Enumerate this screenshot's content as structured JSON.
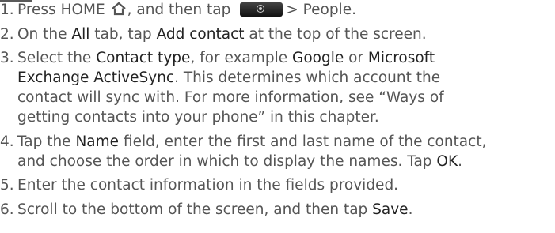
{
  "steps": [
    {
      "num": "1.",
      "parts": {
        "t1": "Press HOME",
        "t2": ", and then tap",
        "t3": "> People."
      }
    },
    {
      "num": "2.",
      "parts": {
        "t1": "On the ",
        "k1": "All",
        "t2": " tab, tap ",
        "k2": "Add contact",
        "t3": " at the top of the screen."
      }
    },
    {
      "num": "3.",
      "parts": {
        "t1": "Select the ",
        "k1": "Contact type",
        "t2": ", for example ",
        "k2": "Google",
        "t3": " or ",
        "k3": "Microsoft",
        "l2": "Exchange ActiveSync",
        "l2b": ". This determines which account the",
        "l3": "contact will sync with. For more information, see “Ways of",
        "l4": "getting contacts into your phone” in this chapter."
      }
    },
    {
      "num": "4.",
      "parts": {
        "t1": "Tap the ",
        "k1": "Name",
        "t2": " field, enter the first and last name of the contact,",
        "l2": "and choose the order in which to display the names. Tap ",
        "k2": "OK",
        "l2b": "."
      }
    },
    {
      "num": "5.",
      "parts": {
        "t1": "Enter the contact information in the fields provided."
      }
    },
    {
      "num": "6.",
      "parts": {
        "t1": "Scroll to the bottom of the screen, and then tap ",
        "k1": "Save",
        "t2": "."
      }
    }
  ],
  "icons": {
    "home": "home-icon",
    "apps_button": "camera-app-button-icon"
  },
  "colors": {
    "body_text": "#555555",
    "keyword_text": "#222222"
  }
}
